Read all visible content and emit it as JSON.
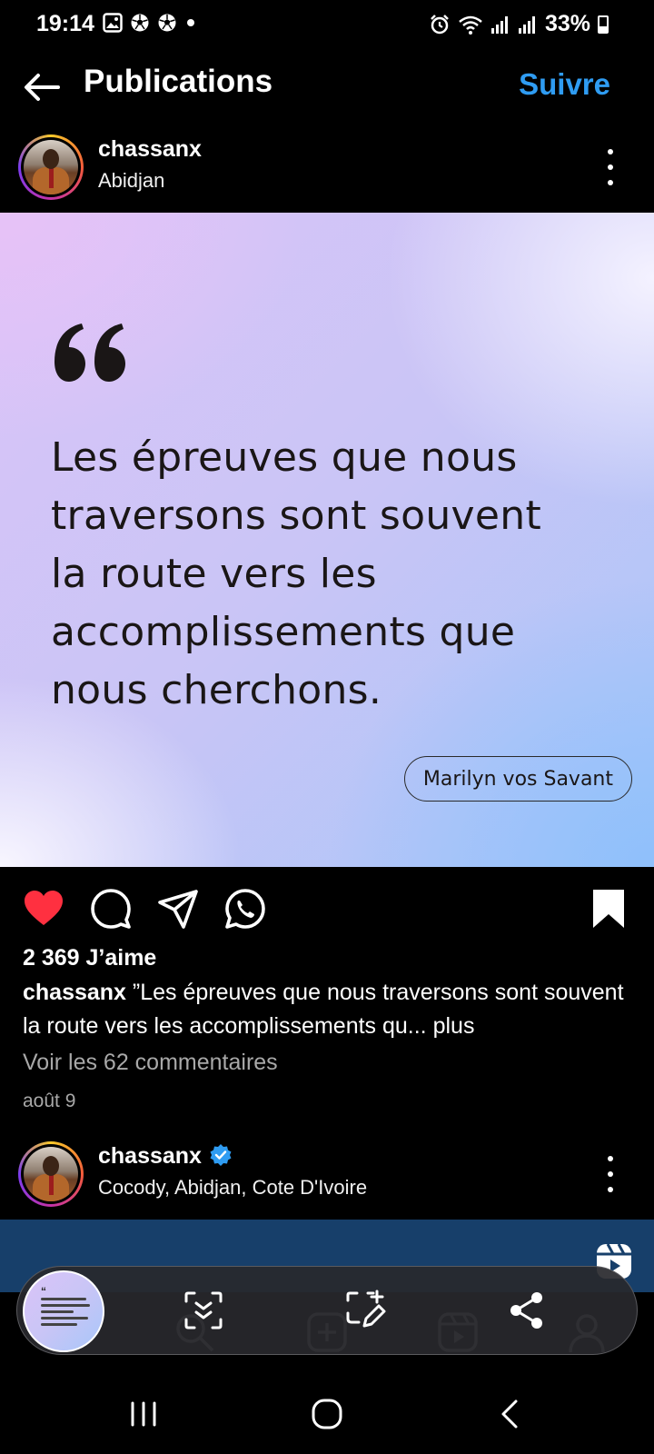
{
  "status_bar": {
    "time": "19:14",
    "battery": "33%",
    "left_icons": [
      "gallery-icon",
      "soccer-ball-icon",
      "soccer-ball-icon",
      "dot-icon"
    ],
    "right_icons": [
      "alarm-icon",
      "wifi-icon",
      "signal-icon",
      "signal-icon",
      "battery-icon"
    ]
  },
  "header": {
    "title": "Publications",
    "follow_label": "Suivre"
  },
  "post": {
    "username": "chassanx",
    "location": "Abidjan",
    "quote_lines": [
      "Les épreuves que nous",
      "traversons sont souvent",
      "la route vers les",
      "accomplissements que",
      "nous cherchons."
    ],
    "author": "Marilyn vos Savant",
    "liked": true,
    "saved": true,
    "likes": "2 369 J’aime",
    "caption_user": "chassanx",
    "caption_text": " ”Les épreuves que nous traversons sont souvent la route vers les accomplissements qu...",
    "caption_more": " plus",
    "comments_link": "Voir les 62 commentaires",
    "date": "août 9"
  },
  "next_post": {
    "username": "chassanx",
    "verified": true,
    "location": "Cocody, Abidjan, Cote D'Ivoire"
  },
  "colors": {
    "accent": "#2f9cf2",
    "like": "#ff3040",
    "background": "#000000",
    "strip": "#173f6a"
  }
}
